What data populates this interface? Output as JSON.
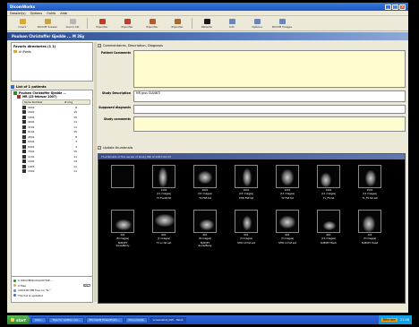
{
  "window": {
    "title": "DicomWorks"
  },
  "menu": [
    "Dossier(s)",
    "Options",
    "Outils",
    "Aide"
  ],
  "toolbar": [
    {
      "label": "Ouvrir",
      "icon": "folder-icon",
      "color": "#d8a93a"
    },
    {
      "label": "DICOM dossier",
      "icon": "dicom-dir-icon",
      "color": "#c9a24a"
    },
    {
      "label": "Ouvrir CD",
      "icon": "cd-icon",
      "color": "#b7b7b7"
    },
    {
      "label": "Exporter",
      "icon": "export-icon",
      "color": "#c23a2a"
    },
    {
      "label": "Exporter",
      "icon": "export2-icon",
      "color": "#c23a2a"
    },
    {
      "label": "Exporter",
      "icon": "export3-icon",
      "color": "#b85a2a"
    },
    {
      "label": "Exporter",
      "icon": "export4-icon",
      "color": "#b0652a"
    },
    {
      "label": "Patients",
      "icon": "patients-icon",
      "color": "#1a1a1a"
    },
    {
      "label": "Info",
      "icon": "info-icon",
      "color": "#6a86b8"
    },
    {
      "label": "Options",
      "icon": "options-icon",
      "color": "#6a86b8"
    },
    {
      "label": "DICOM Images",
      "icon": "dicom-images-icon",
      "color": "#6a86b8"
    }
  ],
  "header": {
    "patient_title": "Poulsen Christoffer Gjedde ... M 26y"
  },
  "favorites": {
    "title": "Favoris directories (1 1)",
    "item": "d:\\Pwds"
  },
  "patient_list": {
    "title": "List of 1 patients",
    "patient_name": "Poulsen Christoffer Gjedde ...",
    "study": "MR (23 februar 2007)",
    "columns": [
      "Série Number",
      "# img"
    ],
    "series": [
      {
        "num": "3001",
        "count": "8"
      },
      {
        "num": "2001",
        "count": "15"
      },
      {
        "num": "1001",
        "count": "15"
      },
      {
        "num": "4001",
        "count": "11"
      },
      {
        "num": "3101",
        "count": "11"
      },
      {
        "num": "6101",
        "count": "15"
      },
      {
        "num": "4501",
        "count": "8"
      },
      {
        "num": "5001",
        "count": "3"
      },
      {
        "num": "6001",
        "count": "3"
      },
      {
        "num": "7001",
        "count": "15"
      },
      {
        "num": "1101",
        "count": "11"
      },
      {
        "num": "1201",
        "count": "13"
      },
      {
        "num": "1401",
        "count": "11"
      },
      {
        "num": "1501",
        "count": "11"
      }
    ]
  },
  "status": {
    "line1": "C:\\DICOMWorks\\OUT\\SE...",
    "line2": "0 files",
    "line2_bar": "0 %",
    "line3": "100/100 MB free on \"D:\"",
    "line4": "The list is updated"
  },
  "comments_section": {
    "title": "Commentaires, Description, Diagnosis",
    "fields": [
      {
        "label": "Patient Comments",
        "value": ""
      },
      {
        "label": "Study Description",
        "value": "MR gros GIANNTI"
      },
      {
        "label": "Supposed diagnosis",
        "value": ""
      },
      {
        "label": "Study comments",
        "value": ""
      }
    ]
  },
  "thumbs_section": {
    "title": "Update thumbnails",
    "bar_label": "Thumbnails of the series of study MR of 2007-02-23",
    "items": [
      {
        "num": "",
        "imgs": "",
        "desc": ""
      },
      {
        "num": "1101",
        "imgs": "(11 images)",
        "desc": "T1 FLAIR fat"
      },
      {
        "num": "1001",
        "imgs": "(15 images)",
        "desc": "T2 FSE fat"
      },
      {
        "num": "1001",
        "imgs": "(15 images)",
        "desc": "STIR FSE fat"
      },
      {
        "num": "1201",
        "imgs": "(13 images)",
        "desc": "T2 FSE fat"
      },
      {
        "num": "1401",
        "imgs": "(11 images)",
        "desc": "T1_FS fat"
      },
      {
        "num": "1501",
        "imgs": "(11 images)",
        "desc": "T1_FS fat sat"
      },
      {
        "num": "301",
        "imgs": "(8 images)",
        "desc": "SURVEY SenseBody"
      },
      {
        "num": "601",
        "imgs": "(1 images)",
        "desc": "T1 sc fat sat"
      },
      {
        "num": "401",
        "imgs": "(8 images)",
        "desc": "SURVEY SenseBody"
      },
      {
        "num": "501",
        "imgs": "(3 images)",
        "desc": "STIR 10 fat sat"
      },
      {
        "num": "601",
        "imgs": "(3 images)",
        "desc": "STIR 10 fat sat"
      },
      {
        "num": "901",
        "imgs": "(11 images)",
        "desc": "SURVEY Neck"
      },
      {
        "num": "101",
        "imgs": "(3 images)",
        "desc": "SURVEY Head"
      }
    ]
  },
  "taskbar": {
    "start": "start",
    "tasks": [
      "Intel...",
      "Tips for written ver...",
      "Microsoft PowerPoint...",
      "Documents",
      "screenshot_DW - Paint"
    ],
    "tray_lang": "Réunion",
    "clock": "21:48"
  }
}
